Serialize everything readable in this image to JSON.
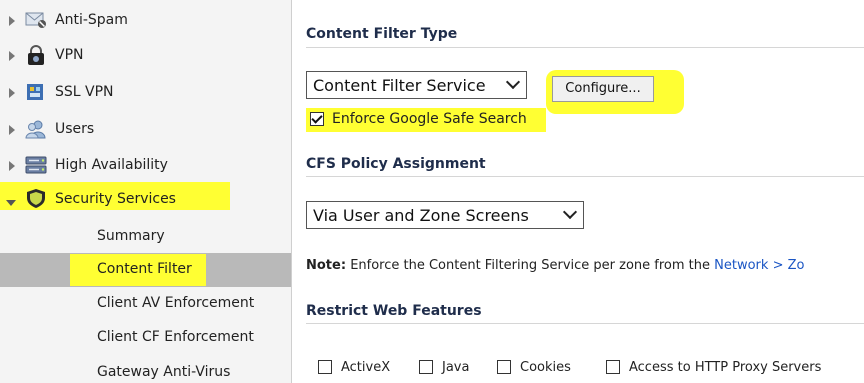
{
  "sidebar": {
    "items": [
      {
        "label": "Anti-Spam",
        "icon": "envelope-icon"
      },
      {
        "label": "VPN",
        "icon": "lock-icon"
      },
      {
        "label": "SSL VPN",
        "icon": "ssl-vpn-icon"
      },
      {
        "label": "Users",
        "icon": "users-icon"
      },
      {
        "label": "High Availability",
        "icon": "server-icon"
      },
      {
        "label": "Security Services",
        "icon": "shield-icon"
      }
    ],
    "subitems": [
      {
        "label": "Summary"
      },
      {
        "label": "Content Filter"
      },
      {
        "label": "Client AV Enforcement"
      },
      {
        "label": "Client CF Enforcement"
      },
      {
        "label": "Gateway Anti-Virus"
      }
    ]
  },
  "main": {
    "type_header": "Content Filter Type",
    "type_select": "Content Filter Service",
    "configure_label": "Configure...",
    "safe_search_label": "Enforce Google Safe Search",
    "policy_header": "CFS Policy Assignment",
    "policy_select": "Via User and Zone Screens",
    "note_prefix": "Note:",
    "note_text": "Enforce the Content Filtering Service per zone from the",
    "note_link": "Network > Zo",
    "restrict_header": "Restrict Web Features",
    "features": [
      "ActiveX",
      "Java",
      "Cookies",
      "Access to HTTP Proxy Servers"
    ]
  },
  "colors": {
    "highlight": "#ffff33",
    "header_text": "#1f2d4b",
    "link": "#1a55c4",
    "selected_row": "#b9b9b9"
  }
}
